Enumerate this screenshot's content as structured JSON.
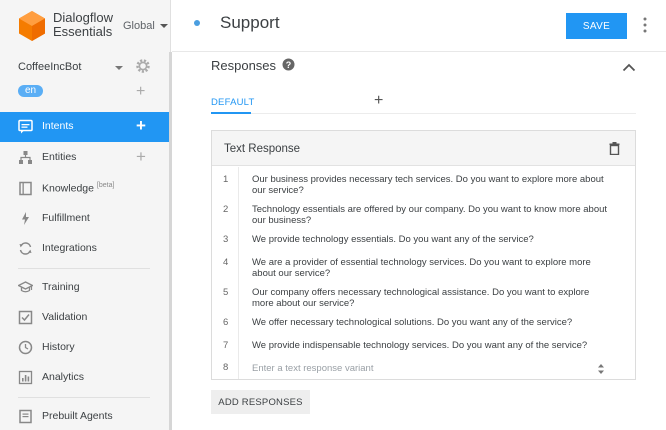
{
  "brand": {
    "line1": "Dialogflow",
    "line2": "Essentials",
    "region": "Global"
  },
  "agent": {
    "name": "CoffeeIncBot",
    "language": "en"
  },
  "sidebar": {
    "items": [
      {
        "label": "Intents",
        "icon": "chat-bubble-icon",
        "active": true
      },
      {
        "label": "Entities",
        "icon": "hierarchy-icon"
      },
      {
        "label": "Knowledge",
        "badge": "[beta]",
        "icon": "book-icon"
      },
      {
        "label": "Fulfillment",
        "icon": "lightning-icon"
      },
      {
        "label": "Integrations",
        "icon": "sync-icon"
      },
      {
        "label": "Training",
        "icon": "graduation-cap-icon"
      },
      {
        "label": "Validation",
        "icon": "checkbox-icon"
      },
      {
        "label": "History",
        "icon": "clock-icon"
      },
      {
        "label": "Analytics",
        "icon": "bar-chart-icon"
      },
      {
        "label": "Prebuilt Agents",
        "icon": "document-icon"
      }
    ]
  },
  "header": {
    "title": "Support",
    "save_label": "SAVE"
  },
  "responses": {
    "title": "Responses",
    "tab_default": "DEFAULT",
    "card_title": "Text Response",
    "rows": [
      {
        "num": "1",
        "text": "Our business provides necessary tech services. Do you want to explore more about our service?"
      },
      {
        "num": "2",
        "text": "Technology essentials are offered by our company. Do you want to know more about our business?"
      },
      {
        "num": "3",
        "text": "We provide technology essentials. Do you want any of the service?"
      },
      {
        "num": "4",
        "text": "We are a provider of essential technology services.  Do you want to explore more about our service?"
      },
      {
        "num": "5",
        "text": "Our company offers necessary technological assistance.  Do you want to explore more about our service?"
      },
      {
        "num": "6",
        "text": "We offer necessary technological solutions. Do you want any of the service?"
      },
      {
        "num": "7",
        "text": "We provide indispensable technology services. Do you want any of the service?"
      },
      {
        "num": "8",
        "placeholder": "Enter a text response variant"
      }
    ],
    "add_label": "ADD RESPONSES"
  },
  "colors": {
    "accent": "#2196f3",
    "logo": "#f57c00"
  }
}
